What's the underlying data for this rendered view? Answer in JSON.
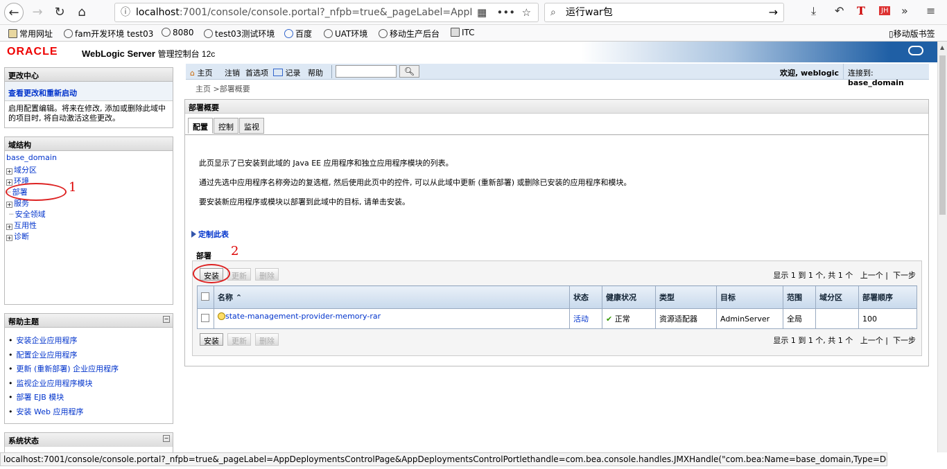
{
  "browser": {
    "url_host": "localhost",
    "url_rest": ":7001/console/console.portal?_nfpb=true&_pageLabel=AppI",
    "search_value": "运行war包",
    "bookmarks": [
      "常用网址",
      "fam开发环境 test03",
      "8080",
      "test03测试环境",
      "百度",
      "UAT环境",
      "移动生产后台",
      "ITC"
    ],
    "mobile_bookmarks": "移动版书签"
  },
  "header": {
    "oracle": "ORACLE",
    "product": "WebLogic Server",
    "subtitle": "管理控制台 12c"
  },
  "toolbar": {
    "home": "主页",
    "logout": "注销",
    "prefs": "首选项",
    "record": "记录",
    "help": "帮助",
    "welcome": "欢迎, weblogic",
    "connected_label": "连接到:",
    "connected_value": "base_domain"
  },
  "breadcrumb": "主页 >部署概要",
  "change_center": {
    "title": "更改中心",
    "link": "查看更改和重新启动",
    "text": "启用配置编辑。将来在修改, 添加或删除此域中的项目时, 将自动激活这些更改。"
  },
  "domain_structure": {
    "title": "域结构",
    "root": "base_domain",
    "items": [
      "域分区",
      "环境",
      "部署",
      "服务",
      "安全领域",
      "互用性",
      "诊断"
    ]
  },
  "help_topics": {
    "title": "帮助主题",
    "items": [
      "安装企业应用程序",
      "配置企业应用程序",
      "更新 (重新部署) 企业应用程序",
      "监视企业应用程序模块",
      "部署 EJB 模块",
      "安装 Web 应用程序"
    ]
  },
  "system_status": {
    "title": "系统状态"
  },
  "main": {
    "title": "部署概要",
    "tabs": [
      "配置",
      "控制",
      "监视"
    ],
    "desc1": "此页显示了已安装到此域的 Java EE 应用程序和独立应用程序模块的列表。",
    "desc2": "通过先选中应用程序名称旁边的复选框, 然后使用此页中的控件, 可以从此域中更新 (重新部署) 或删除已安装的应用程序和模块。",
    "desc3": "要安装新应用程序或模块以部署到此域中的目标, 请单击安装。",
    "customize": "定制此表",
    "section": "部署",
    "install": "安装",
    "update": "更新",
    "delete": "删除",
    "pager_info": "显示 1 到 1 个, 共 1 个",
    "prev": "上一个",
    "next": "下一步",
    "columns": [
      "名称 ⌃",
      "状态",
      "健康状况",
      "类型",
      "目标",
      "范围",
      "域分区",
      "部署顺序"
    ],
    "row": {
      "name": "state-management-provider-memory-rar",
      "state": "活动",
      "health": "正常",
      "type": "资源适配器",
      "target": "AdminServer",
      "scope": "全局",
      "partition": "",
      "order": "100"
    }
  },
  "annotations": {
    "one": "1",
    "two": "2"
  },
  "status_bar": "localhost:7001/console/console.portal?_nfpb=true&_pageLabel=AppDeploymentsControlPage&AppDeploymentsControlPortlethandle=com.bea.console.handles.JMXHandle(\"com.bea:Name=base_domain,Type=Domain\")"
}
